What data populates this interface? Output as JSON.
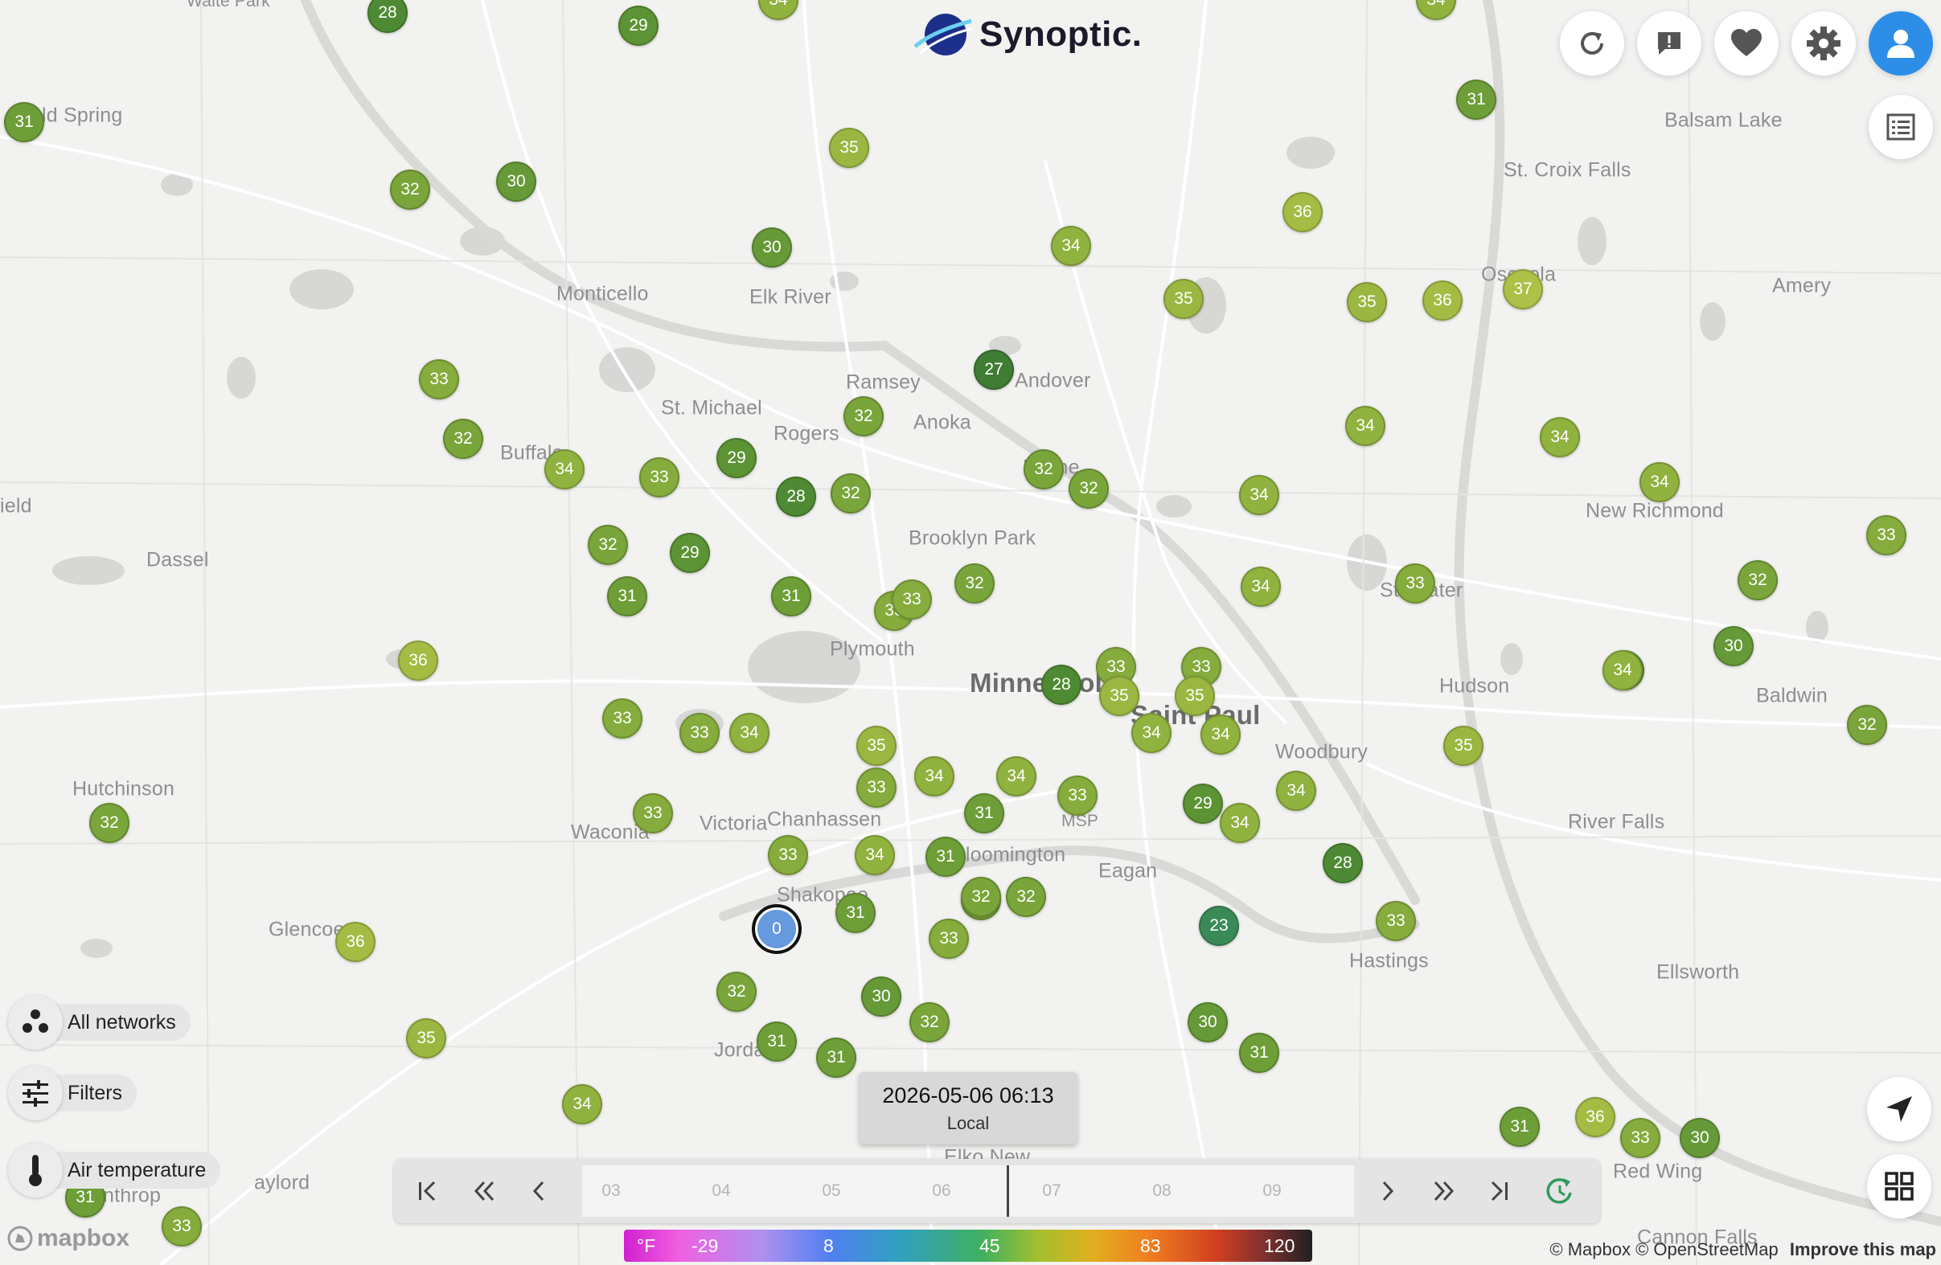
{
  "brand": {
    "name": "Synoptic."
  },
  "places": [
    {
      "name": "Waite Park",
      "cls": "minor"
    },
    {
      "name": "ld Spring",
      "cls": ""
    },
    {
      "name": "Balsam Lake",
      "cls": ""
    },
    {
      "name": "St. Croix Falls",
      "cls": ""
    },
    {
      "name": "Monticello",
      "cls": ""
    },
    {
      "name": "Elk River",
      "cls": ""
    },
    {
      "name": "Osceola",
      "cls": ""
    },
    {
      "name": "Amery",
      "cls": ""
    },
    {
      "name": "Ramsey",
      "cls": ""
    },
    {
      "name": "Andover",
      "cls": ""
    },
    {
      "name": "St. Michael",
      "cls": ""
    },
    {
      "name": "Rogers",
      "cls": ""
    },
    {
      "name": "Anoka",
      "cls": ""
    },
    {
      "name": "Buffalo",
      "cls": ""
    },
    {
      "name": "Blaine",
      "cls": ""
    },
    {
      "name": "New Richmond",
      "cls": ""
    },
    {
      "name": "ield",
      "cls": ""
    },
    {
      "name": "Dassel",
      "cls": ""
    },
    {
      "name": "Brooklyn Park",
      "cls": ""
    },
    {
      "name": "Stillwater",
      "cls": ""
    },
    {
      "name": "Plymouth",
      "cls": ""
    },
    {
      "name": "Minneapolis",
      "cls": "major"
    },
    {
      "name": "Hudson",
      "cls": ""
    },
    {
      "name": "Baldwin",
      "cls": ""
    },
    {
      "name": "Saint Paul",
      "cls": "major"
    },
    {
      "name": "Woodbury",
      "cls": ""
    },
    {
      "name": "Hutchinson",
      "cls": ""
    },
    {
      "name": "Victoria",
      "cls": ""
    },
    {
      "name": "Chanhassen",
      "cls": ""
    },
    {
      "name": "MSP",
      "cls": "minor"
    },
    {
      "name": "Waconia",
      "cls": ""
    },
    {
      "name": "River Falls",
      "cls": ""
    },
    {
      "name": "Bloomington",
      "cls": ""
    },
    {
      "name": "Eagan",
      "cls": ""
    },
    {
      "name": "Shakopee",
      "cls": ""
    },
    {
      "name": "Glencoe",
      "cls": ""
    },
    {
      "name": "Hastings",
      "cls": ""
    },
    {
      "name": "Ellsworth",
      "cls": ""
    },
    {
      "name": "Jordan",
      "cls": ""
    },
    {
      "name": "Elko New",
      "cls": ""
    },
    {
      "name": "Red Wing",
      "cls": ""
    },
    {
      "name": "aylord",
      "cls": ""
    },
    {
      "name": "nthrop",
      "cls": ""
    },
    {
      "name": "Cannon Falls",
      "cls": ""
    }
  ],
  "stations": [
    28,
    29,
    34,
    34,
    31,
    32,
    30,
    35,
    31,
    30,
    34,
    36,
    35,
    35,
    36,
    37,
    33,
    32,
    27,
    32,
    29,
    34,
    33,
    28,
    32,
    32,
    32,
    34,
    34,
    34,
    34,
    33,
    32,
    29,
    31,
    31,
    32,
    33,
    33,
    36,
    33,
    33,
    34,
    33,
    30,
    28,
    35,
    34,
    34,
    33,
    33,
    35,
    34,
    34,
    35,
    34,
    32,
    33,
    33,
    31,
    29,
    34,
    34,
    34,
    35,
    30,
    33,
    34,
    33,
    31,
    32,
    32,
    28,
    36,
    0,
    31,
    33,
    23,
    33,
    32,
    30,
    32,
    31,
    31,
    30,
    31,
    35,
    34,
    36,
    31,
    30,
    33,
    32,
    32,
    32,
    31,
    33
  ],
  "sidebar": {
    "networks_label": "All networks",
    "filters_label": "Filters",
    "variable_label": "Air temperature"
  },
  "time": {
    "datetime": "2026-05-06 06:13",
    "zone": "Local"
  },
  "timeline": {
    "ticks": [
      "03",
      "04",
      "05",
      "06",
      "07",
      "08",
      "09"
    ]
  },
  "legend": {
    "unit": "°F",
    "values": [
      "-29",
      "8",
      "45",
      "83",
      "120"
    ]
  },
  "attribution": {
    "text": "© Mapbox © OpenStreetMap",
    "link": "Improve this map",
    "logo": "mapbox"
  },
  "colors": {
    "cold": "#6699dd",
    "c23": "#3a8a58",
    "c27": "#3f7c34",
    "c28": "#4e8a33",
    "c29": "#5c9334",
    "c30": "#669937",
    "c31": "#6e9e38",
    "c32": "#79a53a",
    "c33": "#85ac3c",
    "c34": "#90b23f",
    "c35": "#9bb742",
    "c36": "#a4bc44",
    "c37": "#adc047"
  }
}
